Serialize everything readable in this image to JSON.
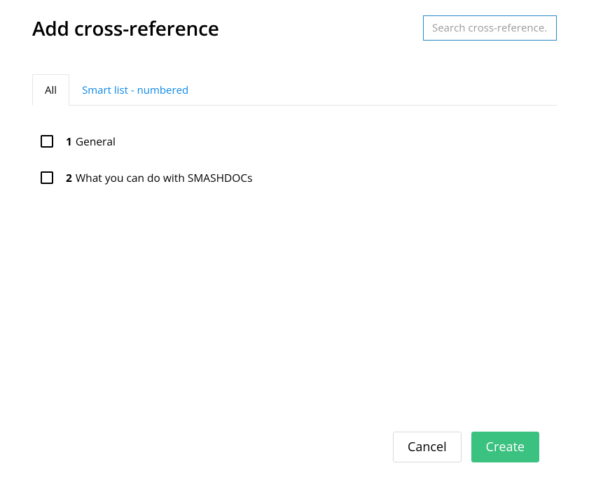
{
  "header": {
    "title": "Add cross-reference"
  },
  "search": {
    "placeholder": "Search cross-reference...",
    "value": ""
  },
  "tabs": [
    {
      "label": "All",
      "active": true
    },
    {
      "label": "Smart list - numbered",
      "active": false
    }
  ],
  "items": [
    {
      "number": "1",
      "label": "General",
      "checked": false
    },
    {
      "number": "2",
      "label": "What you can do with SMASHDOCs",
      "checked": false
    }
  ],
  "footer": {
    "cancel_label": "Cancel",
    "create_label": "Create"
  },
  "colors": {
    "accent_link": "#0d88e8",
    "search_border": "#2888c9",
    "create_button": "#3bc180"
  }
}
